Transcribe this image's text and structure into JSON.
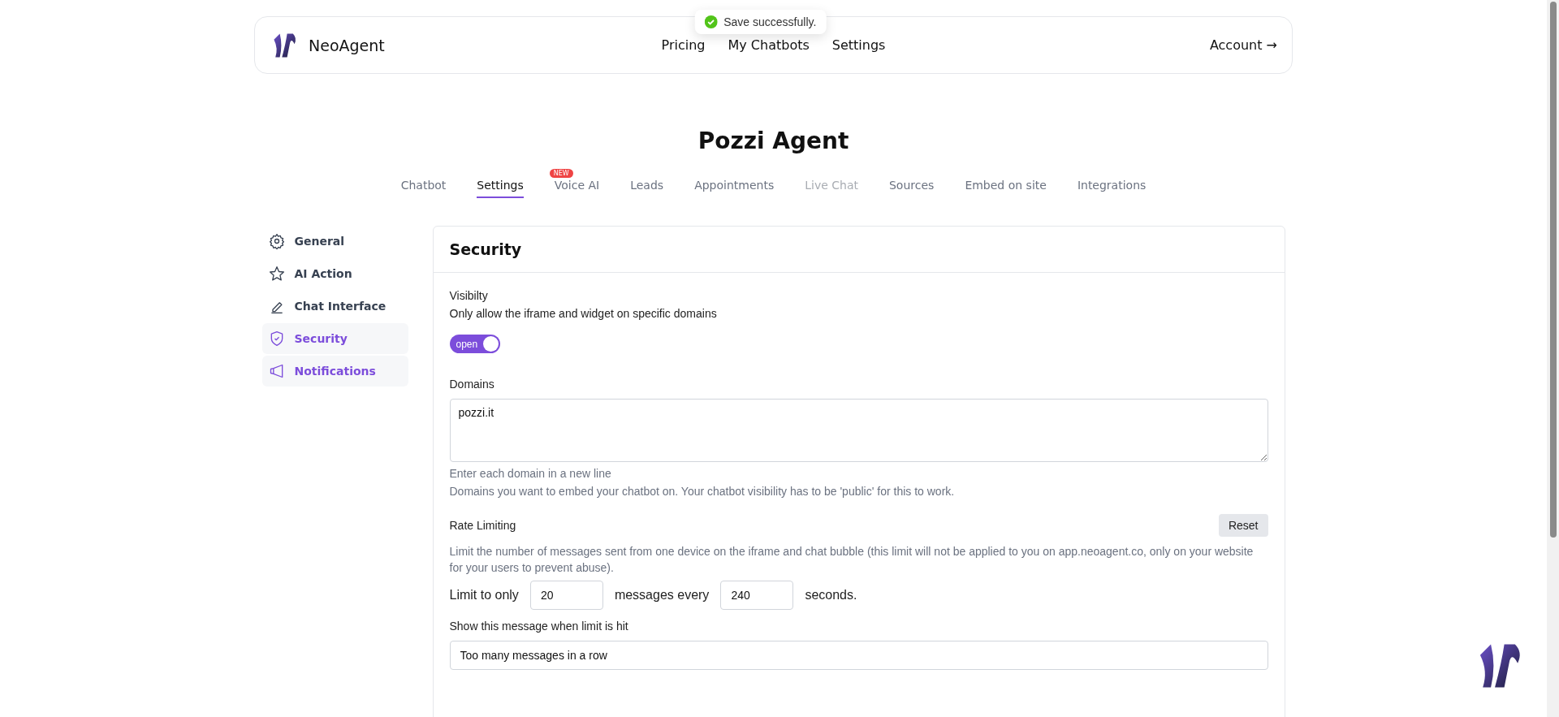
{
  "header": {
    "brand": "NeoAgent",
    "nav": [
      "Pricing",
      "My Chatbots",
      "Settings"
    ],
    "account": "Account →"
  },
  "toast": {
    "message": "Save successfully."
  },
  "title": "Pozzi Agent",
  "tabs": [
    {
      "label": "Chatbot",
      "selected": false,
      "disabled": false
    },
    {
      "label": "Settings",
      "selected": true,
      "disabled": false
    },
    {
      "label": "Voice AI",
      "selected": false,
      "disabled": false,
      "badge": "NEW"
    },
    {
      "label": "Leads",
      "selected": false,
      "disabled": false
    },
    {
      "label": "Appointments",
      "selected": false,
      "disabled": false
    },
    {
      "label": "Live Chat",
      "selected": false,
      "disabled": true
    },
    {
      "label": "Sources",
      "selected": false,
      "disabled": false
    },
    {
      "label": "Embed on site",
      "selected": false,
      "disabled": false
    },
    {
      "label": "Integrations",
      "selected": false,
      "disabled": false
    }
  ],
  "sidebar": {
    "items": [
      {
        "kind": "gear",
        "label": "General",
        "selected": false
      },
      {
        "kind": "star",
        "label": "AI Action",
        "selected": false
      },
      {
        "kind": "pen",
        "label": "Chat Interface",
        "selected": false
      },
      {
        "kind": "shield",
        "label": "Security",
        "selected": true
      },
      {
        "kind": "megaphone",
        "label": "Notifications",
        "selected": true
      }
    ]
  },
  "security": {
    "title": "Security",
    "visibility": {
      "label": "Visibilty",
      "description": "Only allow the iframe and widget on specific domains",
      "toggle_label": "open",
      "on": true
    },
    "domains": {
      "label": "Domains",
      "value": "pozzi.it",
      "hints": [
        "Enter each domain in a new line",
        "Domains you want to embed your chatbot on. Your chatbot visibility has to be 'public' for this to work."
      ]
    },
    "rate_limiting": {
      "label": "Rate Limiting",
      "reset": "Reset",
      "description": "Limit the number of messages sent from one device on the iframe and chat bubble (this limit will not be applied to you on app.neoagent.co, only on your website for your users to prevent abuse).",
      "limit_prefix": "Limit to only",
      "messages": "20",
      "messages_suffix": "messages every",
      "seconds": "240",
      "seconds_suffix": "seconds.",
      "message_label": "Show this message when limit is hit",
      "message": "Too many messages in a row"
    }
  }
}
